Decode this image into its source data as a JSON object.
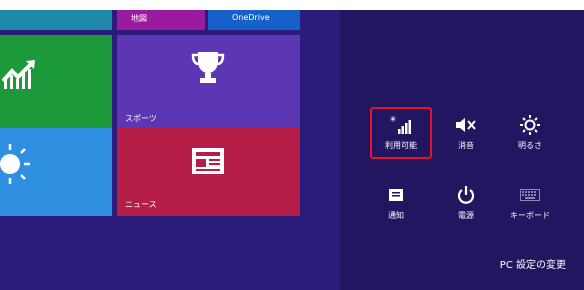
{
  "tiles": {
    "map": {
      "label": "地図",
      "color": "#9b1ba0"
    },
    "onedrive": {
      "label": "OneDrive",
      "color": "#1560c9"
    },
    "finance": {
      "icon": "stock-chart-icon",
      "color": "#1c9a3b"
    },
    "sports": {
      "label": "スポーツ",
      "icon": "trophy-icon",
      "color": "#5d36b4"
    },
    "weather": {
      "icon": "sun-icon",
      "color": "#2f8fe0"
    },
    "news": {
      "label": "ニュース",
      "icon": "newspaper-icon",
      "color": "#b51f47"
    }
  },
  "settings_panel": {
    "quick_settings": [
      {
        "label": "利用可能",
        "icon": "wifi-signal-icon"
      },
      {
        "label": "消音",
        "icon": "mute-speaker-icon"
      },
      {
        "label": "明るさ",
        "icon": "brightness-icon"
      },
      {
        "label": "通知",
        "icon": "notifications-icon"
      },
      {
        "label": "電源",
        "icon": "power-icon"
      },
      {
        "label": "キーボード",
        "icon": "keyboard-icon"
      }
    ],
    "change_pc_settings": "PC 設定の変更",
    "highlight_color": "#e3142a"
  }
}
